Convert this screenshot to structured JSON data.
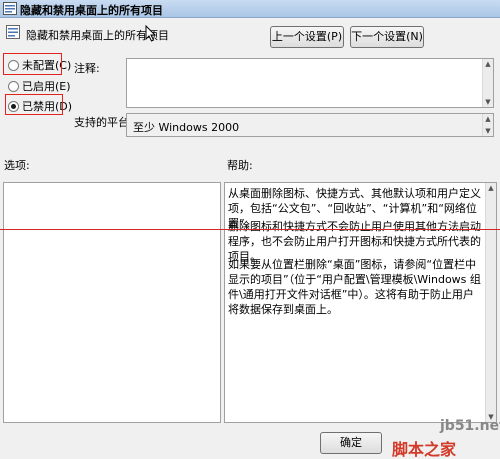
{
  "window": {
    "title": "隐藏和禁用桌面上的所有项目"
  },
  "policy": {
    "name": "隐藏和禁用桌面上的所有项目"
  },
  "nav": {
    "prev_label": "上一个设置(P)",
    "next_label": "下一个设置(N)"
  },
  "state": {
    "options": [
      {
        "label": "未配置(C)",
        "selected": false
      },
      {
        "label": "已启用(E)",
        "selected": false
      },
      {
        "label": "已禁用(D)",
        "selected": true
      }
    ]
  },
  "comment": {
    "label": "注释:",
    "value": ""
  },
  "platform": {
    "label": "支持的平台:",
    "value": "至少 Windows 2000"
  },
  "options_panel": {
    "label": "选项:"
  },
  "help": {
    "label": "帮助:",
    "paragraphs": [
      "从桌面删除图标、快捷方式、其他默认项和用户定义项，包括“公文包”、“回收站”、“计算机”和“网络位置”。",
      "删除图标和快捷方式不会防止用户使用其他方法启动程序，也不会防止用户打开图标和快捷方式所代表的项目。",
      "如果要从位置栏删除“桌面”图标，请参阅“位置栏中显示的项目”（位于“用户配置\\管理模板\\Windows 组件\\通用打开文件对话框”中）。这将有助于防止用户将数据保存到桌面上。"
    ]
  },
  "footer": {
    "ok_label": "确定"
  },
  "watermark": {
    "domain": "jb51.net",
    "name": "脚本之家"
  },
  "colors": {
    "highlight_box": "#e0231b",
    "overlay_line": "#d8232a",
    "titlebar": "#b9d1ea"
  }
}
